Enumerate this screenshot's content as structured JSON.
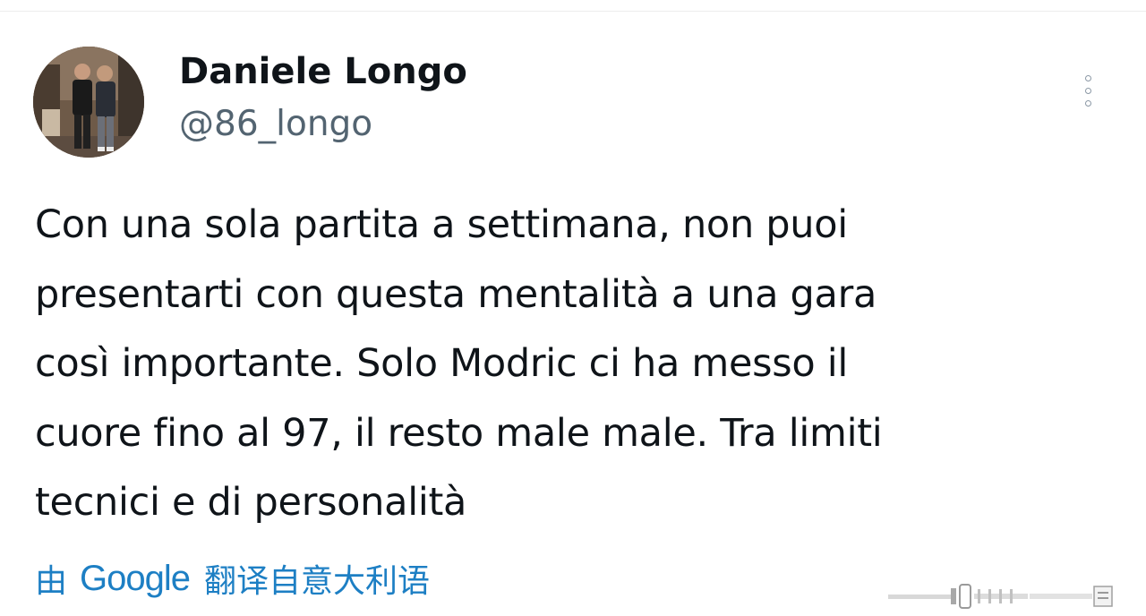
{
  "tweet": {
    "display_name": "Daniele Longo",
    "handle": "@86_longo",
    "text": "Con una sola partita a settimana, non puoi\npresentarti con questa mentalità a una gara\ncosì importante. Solo Modric ci ha messo il\ncuore fino al 97, il resto male male. Tra limiti\ntecnici e di personalità"
  },
  "translate": {
    "prefix": "由",
    "brand": "Google",
    "suffix": "翻译自意大利语"
  },
  "icons": {
    "more": "more-vertical-icon",
    "avatar": "profile-photo",
    "watermark": "barcode-watermark"
  },
  "colors": {
    "text": "#0f1419",
    "secondary": "#536471",
    "link": "#1d7fc4"
  }
}
